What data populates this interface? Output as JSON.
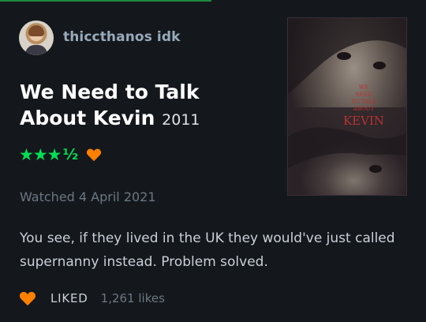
{
  "review": {
    "username": "thiccthanos idk",
    "film_title": "We Need to Talk About Kevin",
    "film_year": "2011",
    "rating_stars": "★★★",
    "rating_half": "½",
    "watched": "Watched 4 April 2021",
    "text": "You see, if they lived in the UK they would've just called supernanny instead. Problem solved.",
    "liked_label": "LIKED",
    "likes_count": "1,261 likes"
  },
  "poster": {
    "title_lines": [
      "WE",
      "NEED",
      "TO TALK",
      "ABOUT"
    ],
    "title_main": "KEVIN"
  },
  "colors": {
    "background": "#14181c",
    "star_green": "#00e054",
    "heart_orange": "#ff8000",
    "poster_red": "#8a2020"
  },
  "icons": {
    "avatar": "user-avatar",
    "rating_heart": "heart-icon",
    "like_heart": "heart-icon"
  }
}
